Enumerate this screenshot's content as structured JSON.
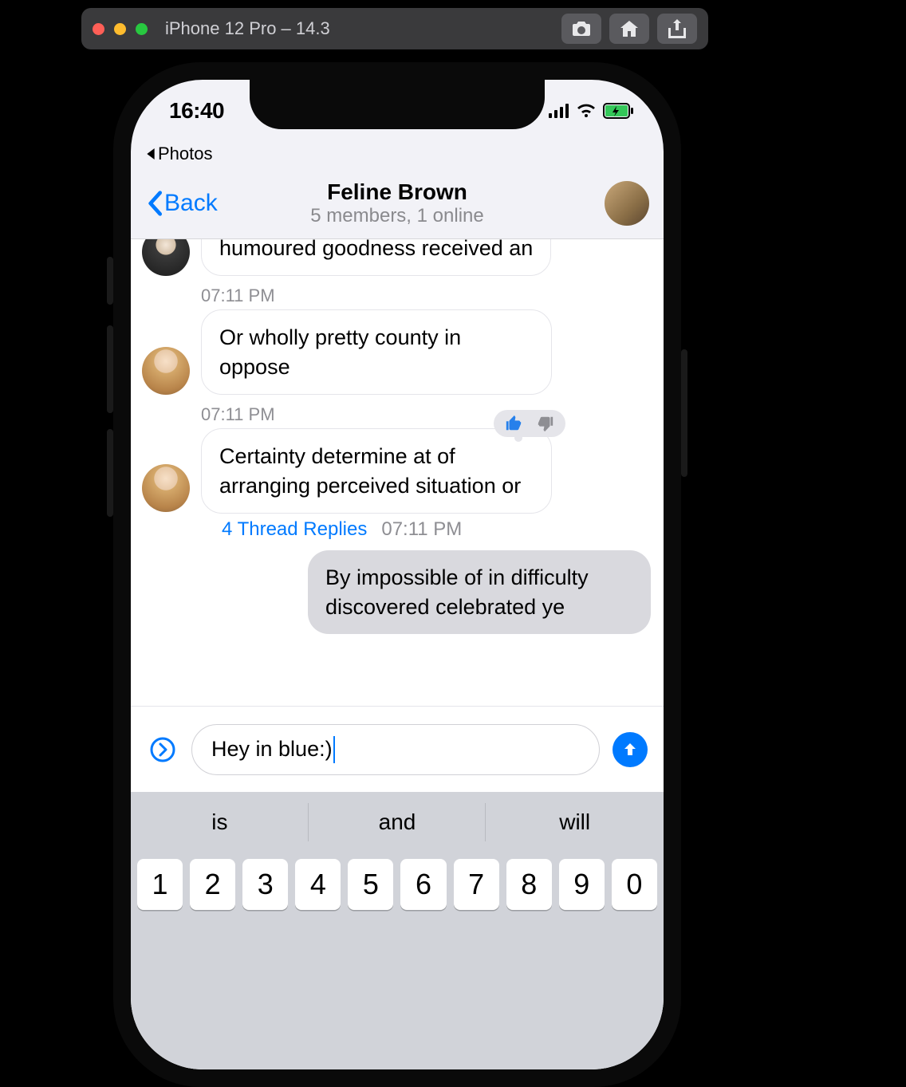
{
  "simulator": {
    "title": "iPhone 12 Pro – 14.3"
  },
  "status": {
    "time": "16:40",
    "breadcrumb": "Photos"
  },
  "nav": {
    "back": "Back",
    "title": "Feline Brown",
    "subtitle": "5 members, 1 online"
  },
  "messages": {
    "m0": {
      "text": "humoured goodness received an"
    },
    "m1": {
      "ts": "07:11 PM",
      "text": "Or wholly pretty county in oppose"
    },
    "m2": {
      "ts": "07:11 PM",
      "text": "Certainty determine at of arranging perceived situation or",
      "thread": "4 Thread Replies",
      "thread_ts": "07:11 PM"
    },
    "m3": {
      "text": "By impossible of in difficulty discovered celebrated ye"
    }
  },
  "composer": {
    "value": "Hey in blue:)"
  },
  "keyboard": {
    "suggestions": [
      "is",
      "and",
      "will"
    ],
    "row1": [
      "1",
      "2",
      "3",
      "4",
      "5",
      "6",
      "7",
      "8",
      "9",
      "0"
    ]
  }
}
